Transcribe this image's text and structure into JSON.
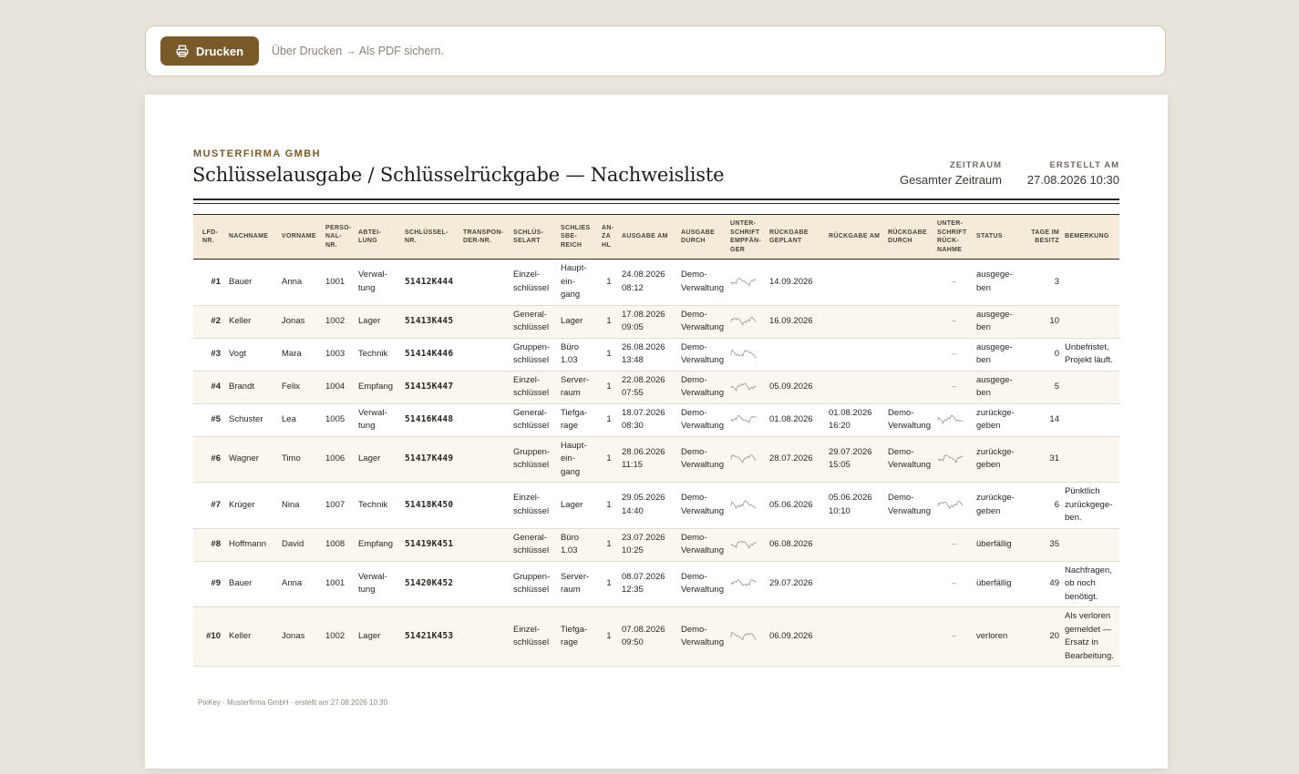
{
  "toolbar": {
    "print_label": "Drucken",
    "print_icon": "printer-icon",
    "hint": "Über Drucken → Als PDF sichern."
  },
  "doc": {
    "company": "MUSTERFIRMA GMBH",
    "title": "Schlüsselausgabe / Schlüsselrückgabe — Nachweisliste",
    "zeitraum_label": "ZEITRAUM",
    "zeitraum_value": "Gesamter Zeitraum",
    "erstellt_label": "ERSTELLT AM",
    "erstellt_value": "27.08.2026 10:30",
    "footer": "PixKey · Musterfirma GmbH · erstellt am 27.08.2026 10:30"
  },
  "columns": [
    "LFD-\nNR.",
    "NACHNAME",
    "VORNAME",
    "PERSO-\nNAL-\nNR.",
    "ABTEI-\nLUNG",
    "SCHLÜSSEL-\nNR.",
    "TRANSPON-\nDER-NR.",
    "SCHLÜS-\nSELART",
    "SCHLIES\nSBE-\nREICH",
    "AN-\nZA\nHL",
    "AUSGABE AM",
    "AUSGABE\nDURCH",
    "UNTER-\nSCHRIFT\nEMPFÄN-\nGER",
    "RÜCKGABE\nGEPLANT",
    "RÜCKGABE AM",
    "RÜCKGABE\nDURCH",
    "UNTER-\nSCHRIFT\nRÜCK-\nNAHME",
    "STATUS",
    "TAGE IM\nBESITZ",
    "BEMERKUNG"
  ],
  "rows": [
    {
      "nr": "#1",
      "nachname": "Bauer",
      "vorname": "Anna",
      "pnr": "1001",
      "abt": "Verwal-\ntung",
      "key": "51412K444",
      "transponder": "",
      "art": "Einzel-\nschlüssel",
      "bereich": "Haupt-\nein-\ngang",
      "anzahl": "1",
      "ausgabe": "24.08.2026\n08:12",
      "durch": "Demo-\nVerwaltung",
      "sig": true,
      "geplant": "14.09.2026",
      "rueck": "",
      "rdurch": "",
      "rsig": "–",
      "status": "ausgege-\nben",
      "tage": "3",
      "bem": ""
    },
    {
      "nr": "#2",
      "nachname": "Keller",
      "vorname": "Jonas",
      "pnr": "1002",
      "abt": "Lager",
      "key": "51413K445",
      "transponder": "",
      "art": "General-\nschlüssel",
      "bereich": "Lager",
      "anzahl": "1",
      "ausgabe": "17.08.2026\n09:05",
      "durch": "Demo-\nVerwaltung",
      "sig": true,
      "geplant": "16.09.2026",
      "rueck": "",
      "rdurch": "",
      "rsig": "–",
      "status": "ausgege-\nben",
      "tage": "10",
      "bem": ""
    },
    {
      "nr": "#3",
      "nachname": "Vogt",
      "vorname": "Mara",
      "pnr": "1003",
      "abt": "Technik",
      "key": "51414K446",
      "transponder": "",
      "art": "Gruppen-\nschlüssel",
      "bereich": "Büro\n1.03",
      "anzahl": "1",
      "ausgabe": "26.08.2026\n13:48",
      "durch": "Demo-\nVerwaltung",
      "sig": true,
      "geplant": "",
      "rueck": "",
      "rdurch": "",
      "rsig": "–",
      "status": "ausgege-\nben",
      "tage": "0",
      "bem": "Unbefristet,\nProjekt läuft."
    },
    {
      "nr": "#4",
      "nachname": "Brandt",
      "vorname": "Felix",
      "pnr": "1004",
      "abt": "Empfang",
      "key": "51415K447",
      "transponder": "",
      "art": "Einzel-\nschlüssel",
      "bereich": "Server-\nraum",
      "anzahl": "1",
      "ausgabe": "22.08.2026\n07:55",
      "durch": "Demo-\nVerwaltung",
      "sig": true,
      "geplant": "05.09.2026",
      "rueck": "",
      "rdurch": "",
      "rsig": "–",
      "status": "ausgege-\nben",
      "tage": "5",
      "bem": ""
    },
    {
      "nr": "#5",
      "nachname": "Schuster",
      "vorname": "Lea",
      "pnr": "1005",
      "abt": "Verwal-\ntung",
      "key": "51416K448",
      "transponder": "",
      "art": "General-\nschlüssel",
      "bereich": "Tiefga-\nrage",
      "anzahl": "1",
      "ausgabe": "18.07.2026\n08:30",
      "durch": "Demo-\nVerwaltung",
      "sig": true,
      "geplant": "01.08.2026",
      "rueck": "01.08.2026\n16:20",
      "rdurch": "Demo-\nVerwaltung",
      "rsig": "sig",
      "status": "zurückge-\ngeben",
      "tage": "14",
      "bem": ""
    },
    {
      "nr": "#6",
      "nachname": "Wagner",
      "vorname": "Timo",
      "pnr": "1006",
      "abt": "Lager",
      "key": "51417K449",
      "transponder": "",
      "art": "Gruppen-\nschlüssel",
      "bereich": "Haupt-\nein-\ngang",
      "anzahl": "1",
      "ausgabe": "28.06.2026\n11:15",
      "durch": "Demo-\nVerwaltung",
      "sig": true,
      "geplant": "28.07.2026",
      "rueck": "29.07.2026\n15:05",
      "rdurch": "Demo-\nVerwaltung",
      "rsig": "sig",
      "status": "zurückge-\ngeben",
      "tage": "31",
      "bem": ""
    },
    {
      "nr": "#7",
      "nachname": "Krüger",
      "vorname": "Nina",
      "pnr": "1007",
      "abt": "Technik",
      "key": "51418K450",
      "transponder": "",
      "art": "Einzel-\nschlüssel",
      "bereich": "Lager",
      "anzahl": "1",
      "ausgabe": "29.05.2026\n14:40",
      "durch": "Demo-\nVerwaltung",
      "sig": true,
      "geplant": "05.06.2026",
      "rueck": "05.06.2026\n10:10",
      "rdurch": "Demo-\nVerwaltung",
      "rsig": "sig",
      "status": "zurückge-\ngeben",
      "tage": "6",
      "bem": "Pünktlich\nzurückgege-\nben."
    },
    {
      "nr": "#8",
      "nachname": "Hoffmann",
      "vorname": "David",
      "pnr": "1008",
      "abt": "Empfang",
      "key": "51419K451",
      "transponder": "",
      "art": "General-\nschlüssel",
      "bereich": "Büro\n1.03",
      "anzahl": "1",
      "ausgabe": "23.07.2026\n10:25",
      "durch": "Demo-\nVerwaltung",
      "sig": true,
      "geplant": "06.08.2026",
      "rueck": "",
      "rdurch": "",
      "rsig": "–",
      "status": "überfällig",
      "tage": "35",
      "bem": ""
    },
    {
      "nr": "#9",
      "nachname": "Bauer",
      "vorname": "Anna",
      "pnr": "1001",
      "abt": "Verwal-\ntung",
      "key": "51420K452",
      "transponder": "",
      "art": "Gruppen-\nschlüssel",
      "bereich": "Server-\nraum",
      "anzahl": "1",
      "ausgabe": "08.07.2026\n12:35",
      "durch": "Demo-\nVerwaltung",
      "sig": true,
      "geplant": "29.07.2026",
      "rueck": "",
      "rdurch": "",
      "rsig": "–",
      "status": "überfällig",
      "tage": "49",
      "bem": "Nachfragen,\nob noch\nbenötigt."
    },
    {
      "nr": "#10",
      "nachname": "Keller",
      "vorname": "Jonas",
      "pnr": "1002",
      "abt": "Lager",
      "key": "51421K453",
      "transponder": "",
      "art": "Einzel-\nschlüssel",
      "bereich": "Tiefga-\nrage",
      "anzahl": "1",
      "ausgabe": "07.08.2026\n09:50",
      "durch": "Demo-\nVerwaltung",
      "sig": true,
      "geplant": "06.09.2026",
      "rueck": "",
      "rdurch": "",
      "rsig": "–",
      "status": "verloren",
      "tage": "20",
      "bem": "Als verloren\ngemeldet —\nErsatz in\nBearbeitung."
    }
  ]
}
